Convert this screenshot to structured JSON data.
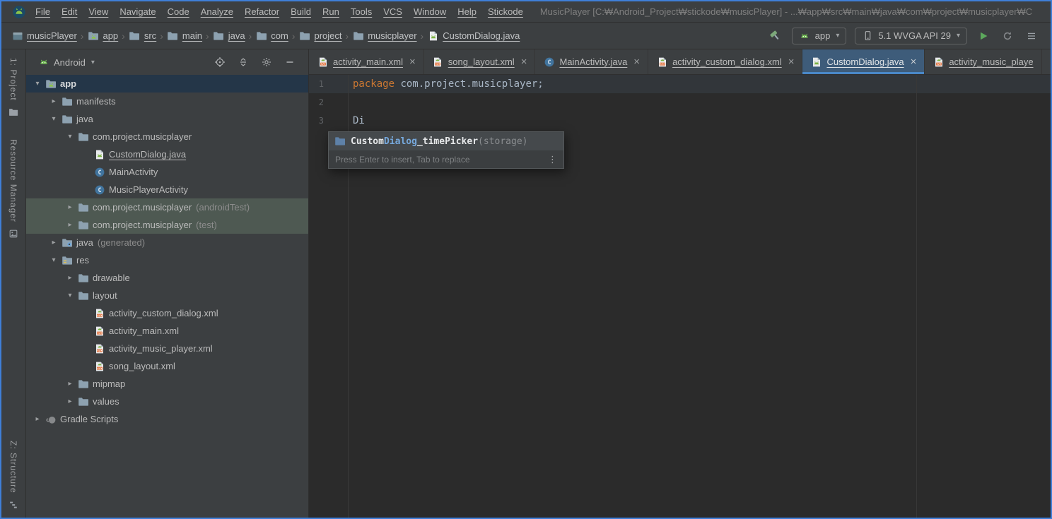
{
  "window": {
    "title": "MusicPlayer [C:₩Android_Project₩stickode₩musicPlayer] - ...₩app₩src₩main₩java₩com₩project₩musicplayer₩C",
    "accent_color": "#4A88C7",
    "border_color": "#3F7FD8"
  },
  "menubar": {
    "menus": [
      "File",
      "Edit",
      "View",
      "Navigate",
      "Code",
      "Analyze",
      "Refactor",
      "Build",
      "Run",
      "Tools",
      "VCS",
      "Window",
      "Help",
      "Stickode"
    ]
  },
  "toolbar": {
    "breadcrumbs": [
      {
        "label": "musicPlayer",
        "icon": "project"
      },
      {
        "label": "app",
        "icon": "android-module"
      },
      {
        "label": "src",
        "icon": "folder"
      },
      {
        "label": "main",
        "icon": "folder"
      },
      {
        "label": "java",
        "icon": "folder"
      },
      {
        "label": "com",
        "icon": "folder"
      },
      {
        "label": "project",
        "icon": "folder"
      },
      {
        "label": "musicplayer",
        "icon": "folder"
      },
      {
        "label": "CustomDialog.java",
        "icon": "android-file"
      }
    ],
    "run_config": "app",
    "device": "5.1 WVGA API 29"
  },
  "tool_stripe": {
    "project": "1: Project",
    "resource_manager": "Resource Manager",
    "structure": "Z: Structure"
  },
  "project_panel": {
    "view_selector": "Android",
    "tree": [
      {
        "label": "app",
        "icon": "android-module",
        "depth": 0,
        "chevron": "expanded",
        "bold": true,
        "selected": "blue"
      },
      {
        "label": "manifests",
        "icon": "folder",
        "depth": 1,
        "chevron": "collapsed"
      },
      {
        "label": "java",
        "icon": "folder",
        "depth": 1,
        "chevron": "expanded"
      },
      {
        "label": "com.project.musicplayer",
        "icon": "folder",
        "depth": 2,
        "chevron": "expanded"
      },
      {
        "label": "CustomDialog.java",
        "icon": "android-file",
        "depth": 3,
        "underline": true
      },
      {
        "label": "MainActivity",
        "icon": "class",
        "depth": 3
      },
      {
        "label": "MusicPlayerActivity",
        "icon": "class",
        "depth": 3
      },
      {
        "label": "com.project.musicplayer",
        "suffix": "(androidTest)",
        "icon": "folder",
        "depth": 2,
        "chevron": "collapsed",
        "selected": "green"
      },
      {
        "label": "com.project.musicplayer",
        "suffix": "(test)",
        "icon": "folder",
        "depth": 2,
        "chevron": "collapsed",
        "selected": "green"
      },
      {
        "label": "java",
        "suffix": "(generated)",
        "icon": "folder-generated",
        "depth": 1,
        "chevron": "collapsed"
      },
      {
        "label": "res",
        "icon": "folder-res",
        "depth": 1,
        "chevron": "expanded"
      },
      {
        "label": "drawable",
        "icon": "folder",
        "depth": 2,
        "chevron": "collapsed"
      },
      {
        "label": "layout",
        "icon": "folder",
        "depth": 2,
        "chevron": "expanded"
      },
      {
        "label": "activity_custom_dialog.xml",
        "icon": "xml-file",
        "depth": 3
      },
      {
        "label": "activity_main.xml",
        "icon": "xml-file",
        "depth": 3
      },
      {
        "label": "activity_music_player.xml",
        "icon": "xml-file",
        "depth": 3
      },
      {
        "label": "song_layout.xml",
        "icon": "xml-file",
        "depth": 3
      },
      {
        "label": "mipmap",
        "icon": "folder",
        "depth": 2,
        "chevron": "collapsed"
      },
      {
        "label": "values",
        "icon": "folder",
        "depth": 2,
        "chevron": "collapsed"
      },
      {
        "label": "Gradle Scripts",
        "icon": "gradle",
        "depth": 0,
        "chevron": "collapsed"
      }
    ]
  },
  "editor": {
    "tabs": [
      {
        "label": "activity_main.xml",
        "icon": "xml-file",
        "closable": true
      },
      {
        "label": "song_layout.xml",
        "icon": "xml-file",
        "closable": true
      },
      {
        "label": "MainActivity.java",
        "icon": "class",
        "closable": true
      },
      {
        "label": "activity_custom_dialog.xml",
        "icon": "xml-file",
        "closable": true
      },
      {
        "label": "CustomDialog.java",
        "icon": "android-file",
        "closable": true,
        "active": true
      },
      {
        "label": "activity_music_playe",
        "icon": "xml-file",
        "closable": false
      }
    ],
    "lines": [
      {
        "highlight": true,
        "segments": [
          {
            "text": "package ",
            "style": "keyword"
          },
          {
            "text": "com.project.musicplayer;",
            "style": "plain"
          }
        ]
      },
      {
        "segments": []
      },
      {
        "segments": [
          {
            "text": "Di",
            "style": "plain"
          }
        ]
      }
    ],
    "completion": {
      "segments": [
        {
          "text": "Custom",
          "style": "name"
        },
        {
          "text": "Dialog",
          "style": "match"
        },
        {
          "text": "_timePicker",
          "style": "name"
        },
        {
          "text": "(storage)",
          "style": "tail"
        }
      ],
      "hint": "Press Enter to insert, Tab to replace"
    }
  },
  "syntax_colors": {
    "keyword": "#CC7832",
    "plain": "#A9B7C6",
    "line_number": "#606366",
    "tree_selection_green": "#4E5952",
    "tree_selection_blue": "#243648"
  },
  "icons": {
    "android-studio-logo-icon": "android-studio-disc",
    "build-hammer-icon": "green-hammer",
    "run-icon": "green-play-triangle",
    "sync-icon": "circular-arrow",
    "more-actions-icon": "three-lines",
    "phone-icon": "device-outline",
    "android-head-icon": "green-android-head",
    "locate-icon": "crosshair-target",
    "collapse-all-icon": "chevrons-and-line",
    "gear-icon": "gear",
    "hide-panel-icon": "minus",
    "chevron-down-icon": "▾",
    "breadcrumb-separator-icon": "›",
    "close-tab-icon": "×",
    "overflow-dots-icon": "⋮",
    "folder-icon": "blue-grey-folder"
  }
}
